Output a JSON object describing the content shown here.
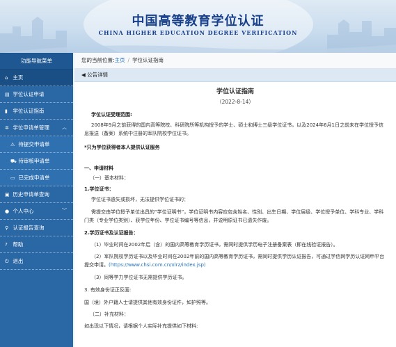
{
  "header": {
    "title": "中国高等教育学位认证",
    "subtitle": "CHINA HIGHER EDUCATION DEGREE VERIFICATION"
  },
  "sidebar": {
    "menu_title": "功能导航菜单",
    "items": [
      {
        "label": "主页",
        "icon": "home-icon"
      },
      {
        "label": "学位认证申请",
        "icon": "document-icon"
      },
      {
        "label": "学位认证指南",
        "icon": "bookmark-icon"
      },
      {
        "label": "学位申请单管理",
        "icon": "gear-icon",
        "expanded": true
      },
      {
        "label": "待提交申请单",
        "icon": "warning-icon"
      },
      {
        "label": "待审核申请单",
        "icon": "cart-icon"
      },
      {
        "label": "已完成申请单",
        "icon": "inbox-icon"
      },
      {
        "label": "历史申请单查询",
        "icon": "monitor-icon"
      },
      {
        "label": "个人中心",
        "icon": "user-icon",
        "expanded": false
      },
      {
        "label": "认证报告查询",
        "icon": "search-icon"
      },
      {
        "label": "帮助",
        "icon": "question-icon"
      },
      {
        "label": "退出",
        "icon": "power-icon"
      }
    ]
  },
  "breadcrumb": {
    "prefix": "您的当前位置:",
    "home": "主页",
    "separator": "/",
    "current": "学位认证指南"
  },
  "panel": {
    "title": "公告详情"
  },
  "doc": {
    "title": "学位认证指南",
    "date": "（2022-8-14）",
    "scope_heading": "学位认证受理范围:",
    "scope_text": "2008年9月之前获得的国内高等院校、科研院所等机构授予的学士、硕士和博士三级学位证书，以及2024年6月1日之前未在学位授予信息报送（备案）系统中注册的军队院校学位证书。",
    "notice": "*只为学位获得者本人提供认证服务",
    "s1": "一、申请材料",
    "s1_1": "（一）基本材料：",
    "m1": "1.学位证书：",
    "m1_a": "学位证书遗失或损坏，无法提供学位证书的：",
    "m1_b": "需提交由学位授予单位出具的“学位证明书”，学位证明书内容应包含姓名、性别、出生日期、学位层级、学位授予单位、学科专业、学科门类（专业学位类别）、获学位年份、学位证书编号等信息，并说明原证书已遗失作废。",
    "m2": "2.学历证书及认证报告：",
    "m2_1": "（1）毕业时间在2002年后（含）的国内高等教育学历证书，需同时提供学历电子注册备案表（即在线验证报告）。",
    "m2_2": "（2）军队院校学历证书以及毕业时间在2002年前的国内高等教育学历证书，需同时提供学历认证报告，可通过学信网学历认证网申平台提交申请。",
    "m2_2_link": "(https://www.chsi.com.cn/xlrz/index.jsp)",
    "m2_3": "（3）同等学力学位证书无需提供学历证书。",
    "m3": "3. 有效身份证正反面:",
    "m3_a": "国（境）外户籍人士请提供其他有效身份证件，如护照等。",
    "s1_2": "（二）补充材料：",
    "s1_2_a": "如出现以下情况，请根据个人实际补充提供如下材料:"
  },
  "colors": {
    "sidebar_bg": "#2a67a5",
    "title_blue": "#183f8a",
    "link_blue": "#1f6fc0"
  }
}
